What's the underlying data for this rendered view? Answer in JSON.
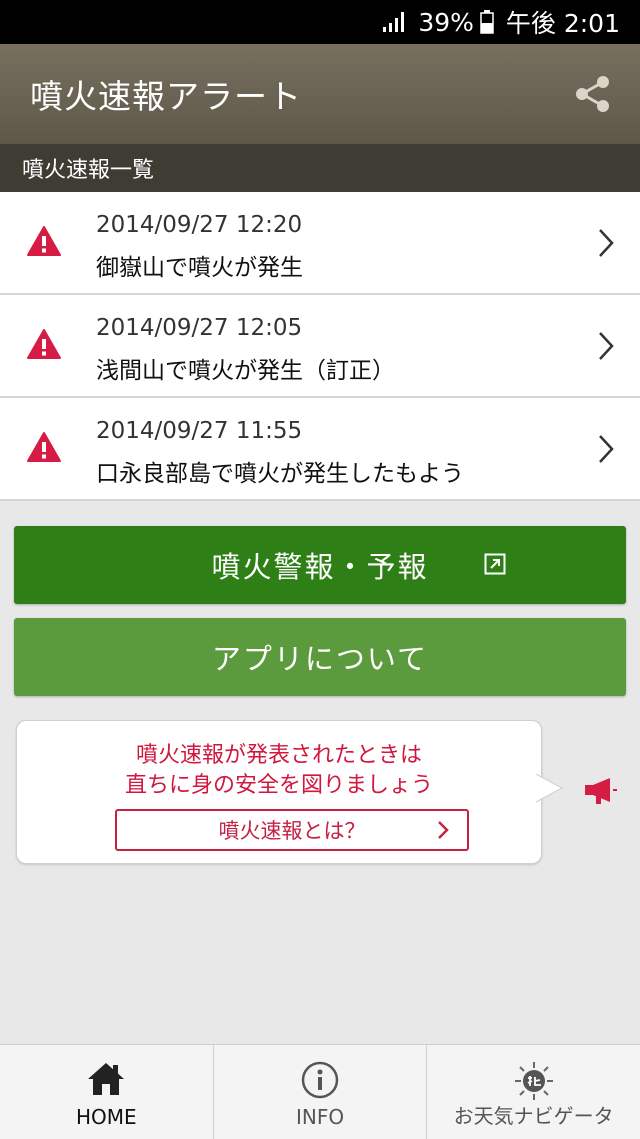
{
  "status_bar": {
    "battery": "39%",
    "time": "午後 2:01"
  },
  "app_bar": {
    "title": "噴火速報アラート"
  },
  "section_header": "噴火速報一覧",
  "alerts": [
    {
      "datetime": "2014/09/27 12:20",
      "message": "御嶽山で噴火が発生"
    },
    {
      "datetime": "2014/09/27 12:05",
      "message": "浅間山で噴火が発生（訂正）"
    },
    {
      "datetime": "2014/09/27 11:55",
      "message": "口永良部島で噴火が発生したもよう"
    }
  ],
  "buttons": {
    "warning_label": "噴火警報・予報",
    "about_label": "アプリについて"
  },
  "bubble": {
    "line1": "噴火速報が発表されたときは",
    "line2": "直ちに身の安全を図りましょう",
    "link_label": "噴火速報とは？"
  },
  "nav": [
    {
      "label": "HOME",
      "active": true
    },
    {
      "label": "INFO",
      "active": false
    },
    {
      "label": "お天気ナビゲータ",
      "active": false
    }
  ],
  "colors": {
    "accent_red": "#d1173d",
    "green_dark": "#2f7f17",
    "green_light": "#5c9b3d",
    "appbar": "#6b6555"
  }
}
